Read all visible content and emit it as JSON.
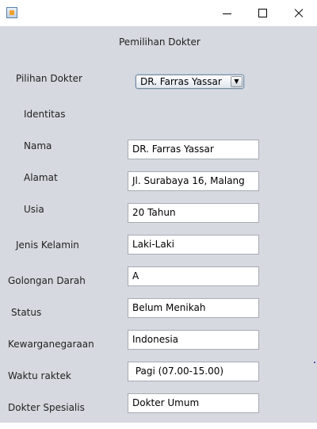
{
  "window": {
    "icon": "java-app-icon",
    "controls": [
      "minimize",
      "maximize",
      "close"
    ]
  },
  "form": {
    "title": "Pemilihan Dokter",
    "doctor_choice_label": "Pilihan Dokter",
    "doctor_choice_value": "DR. Farras Yassar",
    "dropdown_arrow": "▼",
    "identity_heading": "Identitas",
    "fields": [
      {
        "label": "Nama",
        "value": "DR. Farras Yassar"
      },
      {
        "label": "Alamat",
        "value": "Jl. Surabaya 16, Malang"
      },
      {
        "label": "Usia",
        "value": "20 Tahun"
      },
      {
        "label": "Jenis Kelamin",
        "value": "Laki-Laki"
      },
      {
        "label": "Golongan Darah",
        "value": "A"
      },
      {
        "label": "Status",
        "value": "Belum Menikah"
      },
      {
        "label": "Kewarganegaraan",
        "value": "Indonesia"
      },
      {
        "label": "Waktu raktek",
        "value": " Pagi (07.00-15.00)"
      },
      {
        "label": "Dokter Spesialis",
        "value": "Dokter Umum"
      }
    ]
  }
}
